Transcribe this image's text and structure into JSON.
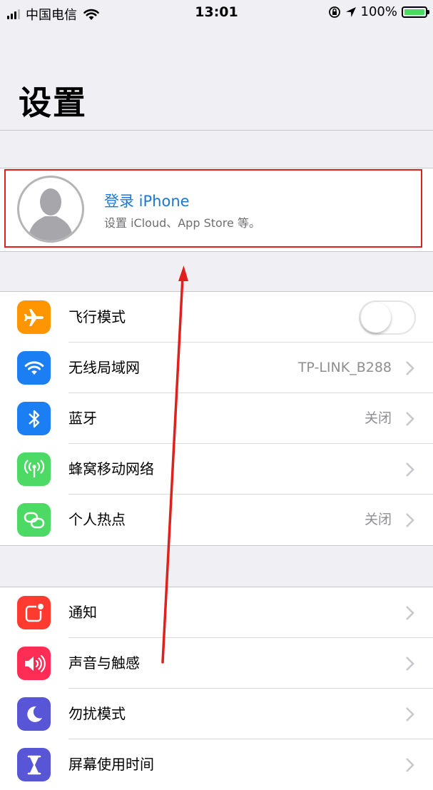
{
  "status_bar": {
    "carrier": "中国电信",
    "time": "13:01",
    "battery": "100%",
    "signal_bars_filled": 3,
    "signal_bars_total": 4
  },
  "page_title": "设置",
  "account": {
    "title": "登录 iPhone",
    "subtitle": "设置 iCloud、App Store 等。"
  },
  "network_group": [
    {
      "name": "airplane",
      "label": "飞行模式",
      "icon": "airplane-icon",
      "color": "#ff9500",
      "toggle": false
    },
    {
      "name": "wifi",
      "label": "无线局域网",
      "icon": "wifi-icon",
      "color": "#1b7ef2",
      "value": "TP-LINK_B288"
    },
    {
      "name": "bluetooth",
      "label": "蓝牙",
      "icon": "bluetooth-icon",
      "color": "#1b7ef2",
      "value": "关闭"
    },
    {
      "name": "cellular",
      "label": "蜂窝移动网络",
      "icon": "antenna-icon",
      "color": "#4cd964"
    },
    {
      "name": "hotspot",
      "label": "个人热点",
      "icon": "hotspot-link-icon",
      "color": "#4cd964",
      "value": "关闭"
    }
  ],
  "system_group": [
    {
      "name": "notifications",
      "label": "通知",
      "icon": "notification-icon",
      "color": "#ff3b30"
    },
    {
      "name": "sounds",
      "label": "声音与触感",
      "icon": "speaker-icon",
      "color": "#ff2d55"
    },
    {
      "name": "dnd",
      "label": "勿扰模式",
      "icon": "moon-icon",
      "color": "#5856d6"
    },
    {
      "name": "screentime",
      "label": "屏幕使用时间",
      "icon": "hourglass-icon",
      "color": "#5856d6"
    }
  ],
  "colors": {
    "link_blue": "#1a78d6",
    "annotation_red": "#e0201c",
    "background": "#efeff4"
  }
}
